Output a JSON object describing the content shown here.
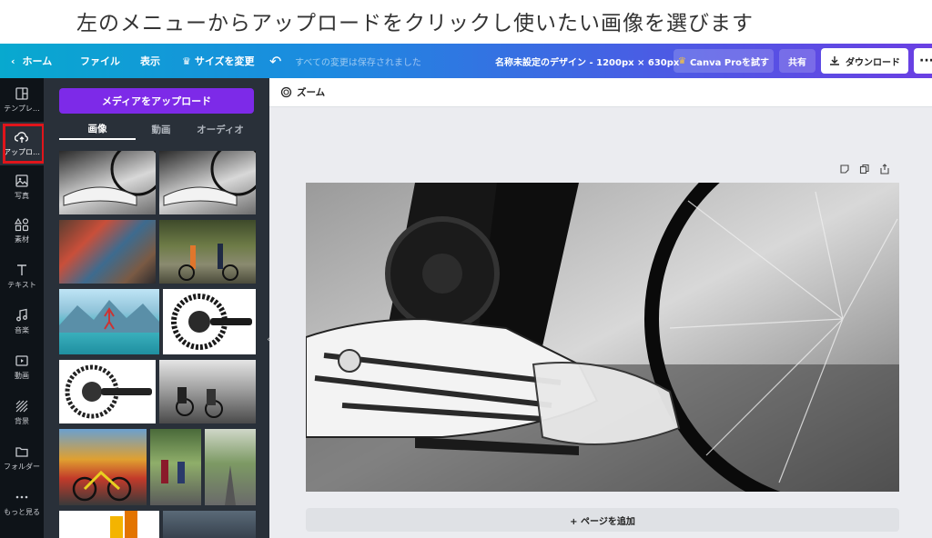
{
  "caption": "左のメニューからアップロードをクリックし使いたい画像を選びます",
  "topbar": {
    "home_label": "ホーム",
    "file_label": "ファイル",
    "view_label": "表示",
    "resize_label": "サイズを変更",
    "saved_status": "すべての変更は保存されました",
    "doc_title": "名称未設定のデザイン - 1200px × 630px",
    "pro_label": "Canva Proを試す",
    "share_label": "共有",
    "download_label": "ダウンロード"
  },
  "sidebar": {
    "items": [
      {
        "label": "テンプレ…",
        "icon": "template-icon"
      },
      {
        "label": "アップロ…",
        "icon": "upload-cloud-icon"
      },
      {
        "label": "写真",
        "icon": "photo-icon"
      },
      {
        "label": "素材",
        "icon": "elements-icon"
      },
      {
        "label": "テキスト",
        "icon": "text-icon"
      },
      {
        "label": "音楽",
        "icon": "music-icon"
      },
      {
        "label": "動画",
        "icon": "video-icon"
      },
      {
        "label": "背景",
        "icon": "background-icon"
      },
      {
        "label": "フォルダー",
        "icon": "folder-icon"
      },
      {
        "label": "もっと見る",
        "icon": "more-dots-icon"
      }
    ]
  },
  "panel": {
    "upload_button": "メディアをアップロード",
    "tabs": [
      "画像",
      "動画",
      "オーディオ"
    ],
    "active_tab": "画像"
  },
  "canvas": {
    "zoom_label": "ズーム",
    "add_page_label": "+ ページを追加"
  },
  "colors": {
    "accent_purple": "#7d2ae8",
    "highlight_red": "#e0151b",
    "topbar_start": "#08a9cf",
    "topbar_end": "#6a3fe3"
  }
}
